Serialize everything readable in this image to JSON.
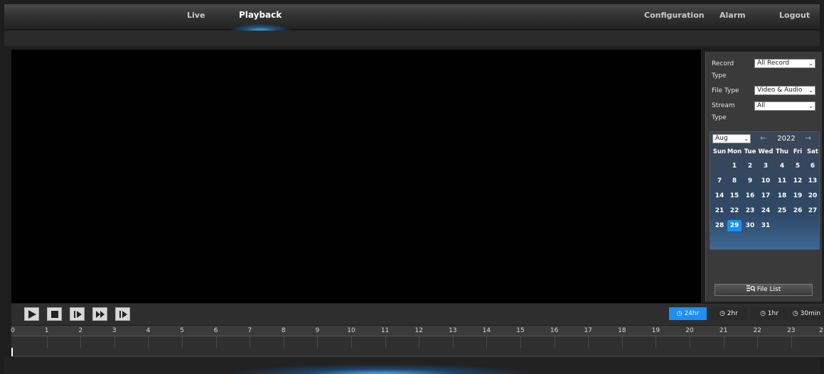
{
  "nav": {
    "live": "Live",
    "playback": "Playback",
    "configuration": "Configuration",
    "alarm": "Alarm",
    "logout": "Logout"
  },
  "search": {
    "record_type_label_1": "Record",
    "record_type_label_2": "Type",
    "record_type_value": "All Record",
    "file_type_label": "File Type",
    "file_type_value": "Video & Audio",
    "stream_type_label_1": "Stream",
    "stream_type_label_2": "Type",
    "stream_type_value": "All"
  },
  "calendar": {
    "month": "Aug",
    "year": "2022",
    "prev_icon": "arrow-left-icon",
    "next_icon": "arrow-right-icon",
    "weekdays": [
      "Sun",
      "Mon",
      "Tue",
      "Wed",
      "Thu",
      "Fri",
      "Sat"
    ],
    "weeks": [
      [
        "",
        "1",
        "2",
        "3",
        "4",
        "5",
        "6"
      ],
      [
        "7",
        "8",
        "9",
        "10",
        "11",
        "12",
        "13"
      ],
      [
        "14",
        "15",
        "16",
        "17",
        "18",
        "19",
        "20"
      ],
      [
        "21",
        "22",
        "23",
        "24",
        "25",
        "26",
        "27"
      ],
      [
        "28",
        "29",
        "30",
        "31",
        "",
        "",
        ""
      ]
    ],
    "selected_day": "29",
    "selected_color": "#1e8ff0"
  },
  "file_list_button": "File List",
  "controls": {
    "play_icon": "play-icon",
    "stop_icon": "stop-icon",
    "slow_icon": "slow-forward-icon",
    "fast_icon": "fast-forward-icon",
    "frame_icon": "single-frame-icon"
  },
  "time_range": {
    "options": [
      "24hr",
      "2hr",
      "1hr",
      "30min"
    ],
    "active": "24hr",
    "active_color": "#1e8ff0"
  },
  "timeline": {
    "hours": [
      "0",
      "1",
      "2",
      "3",
      "4",
      "5",
      "6",
      "7",
      "8",
      "9",
      "10",
      "11",
      "12",
      "13",
      "14",
      "15",
      "16",
      "17",
      "18",
      "19",
      "20",
      "21",
      "22",
      "23",
      "2"
    ]
  }
}
